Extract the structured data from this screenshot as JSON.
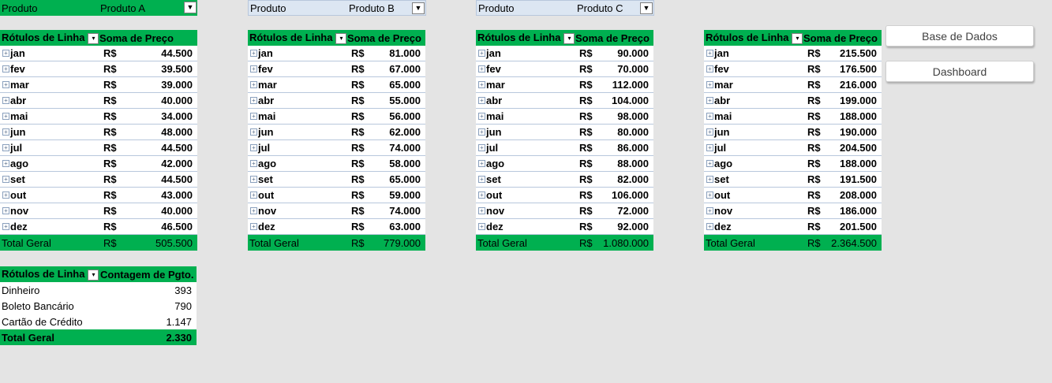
{
  "filters": [
    {
      "label": "Produto",
      "value": "Produto A"
    },
    {
      "label": "Produto",
      "value": "Produto B"
    },
    {
      "label": "Produto",
      "value": "Produto C"
    }
  ],
  "headers": {
    "rows": "Rótulos de Linha",
    "sum": "Soma de Preço",
    "count": "Contagem de Pgto."
  },
  "currency": "R$",
  "months": [
    "jan",
    "fev",
    "mar",
    "abr",
    "mai",
    "jun",
    "jul",
    "ago",
    "set",
    "out",
    "nov",
    "dez"
  ],
  "pivots": [
    {
      "values": [
        "44.500",
        "39.500",
        "39.000",
        "40.000",
        "34.000",
        "48.000",
        "44.500",
        "42.000",
        "44.500",
        "43.000",
        "40.000",
        "46.500"
      ],
      "total": "505.500"
    },
    {
      "values": [
        "81.000",
        "67.000",
        "65.000",
        "55.000",
        "56.000",
        "62.000",
        "74.000",
        "58.000",
        "65.000",
        "59.000",
        "74.000",
        "63.000"
      ],
      "total": "779.000"
    },
    {
      "values": [
        "90.000",
        "70.000",
        "112.000",
        "104.000",
        "98.000",
        "80.000",
        "86.000",
        "88.000",
        "82.000",
        "106.000",
        "72.000",
        "92.000"
      ],
      "total": "1.080.000"
    },
    {
      "values": [
        "215.500",
        "176.500",
        "216.000",
        "199.000",
        "188.000",
        "190.000",
        "204.500",
        "188.000",
        "191.500",
        "208.000",
        "186.000",
        "201.500"
      ],
      "total": "2.364.500"
    }
  ],
  "total_label": "Total Geral",
  "payments": {
    "rows": [
      {
        "label": "Dinheiro",
        "value": "393"
      },
      {
        "label": "Boleto Bancário",
        "value": "790"
      },
      {
        "label": "Cartão de Crédito",
        "value": "1.147"
      }
    ],
    "total": "2.330"
  },
  "buttons": {
    "base": "Base de Dados",
    "dashboard": "Dashboard"
  },
  "colors": {
    "header_green": "#00b050",
    "filter_blue": "#dce6f2",
    "background": "#e4e4e4"
  }
}
